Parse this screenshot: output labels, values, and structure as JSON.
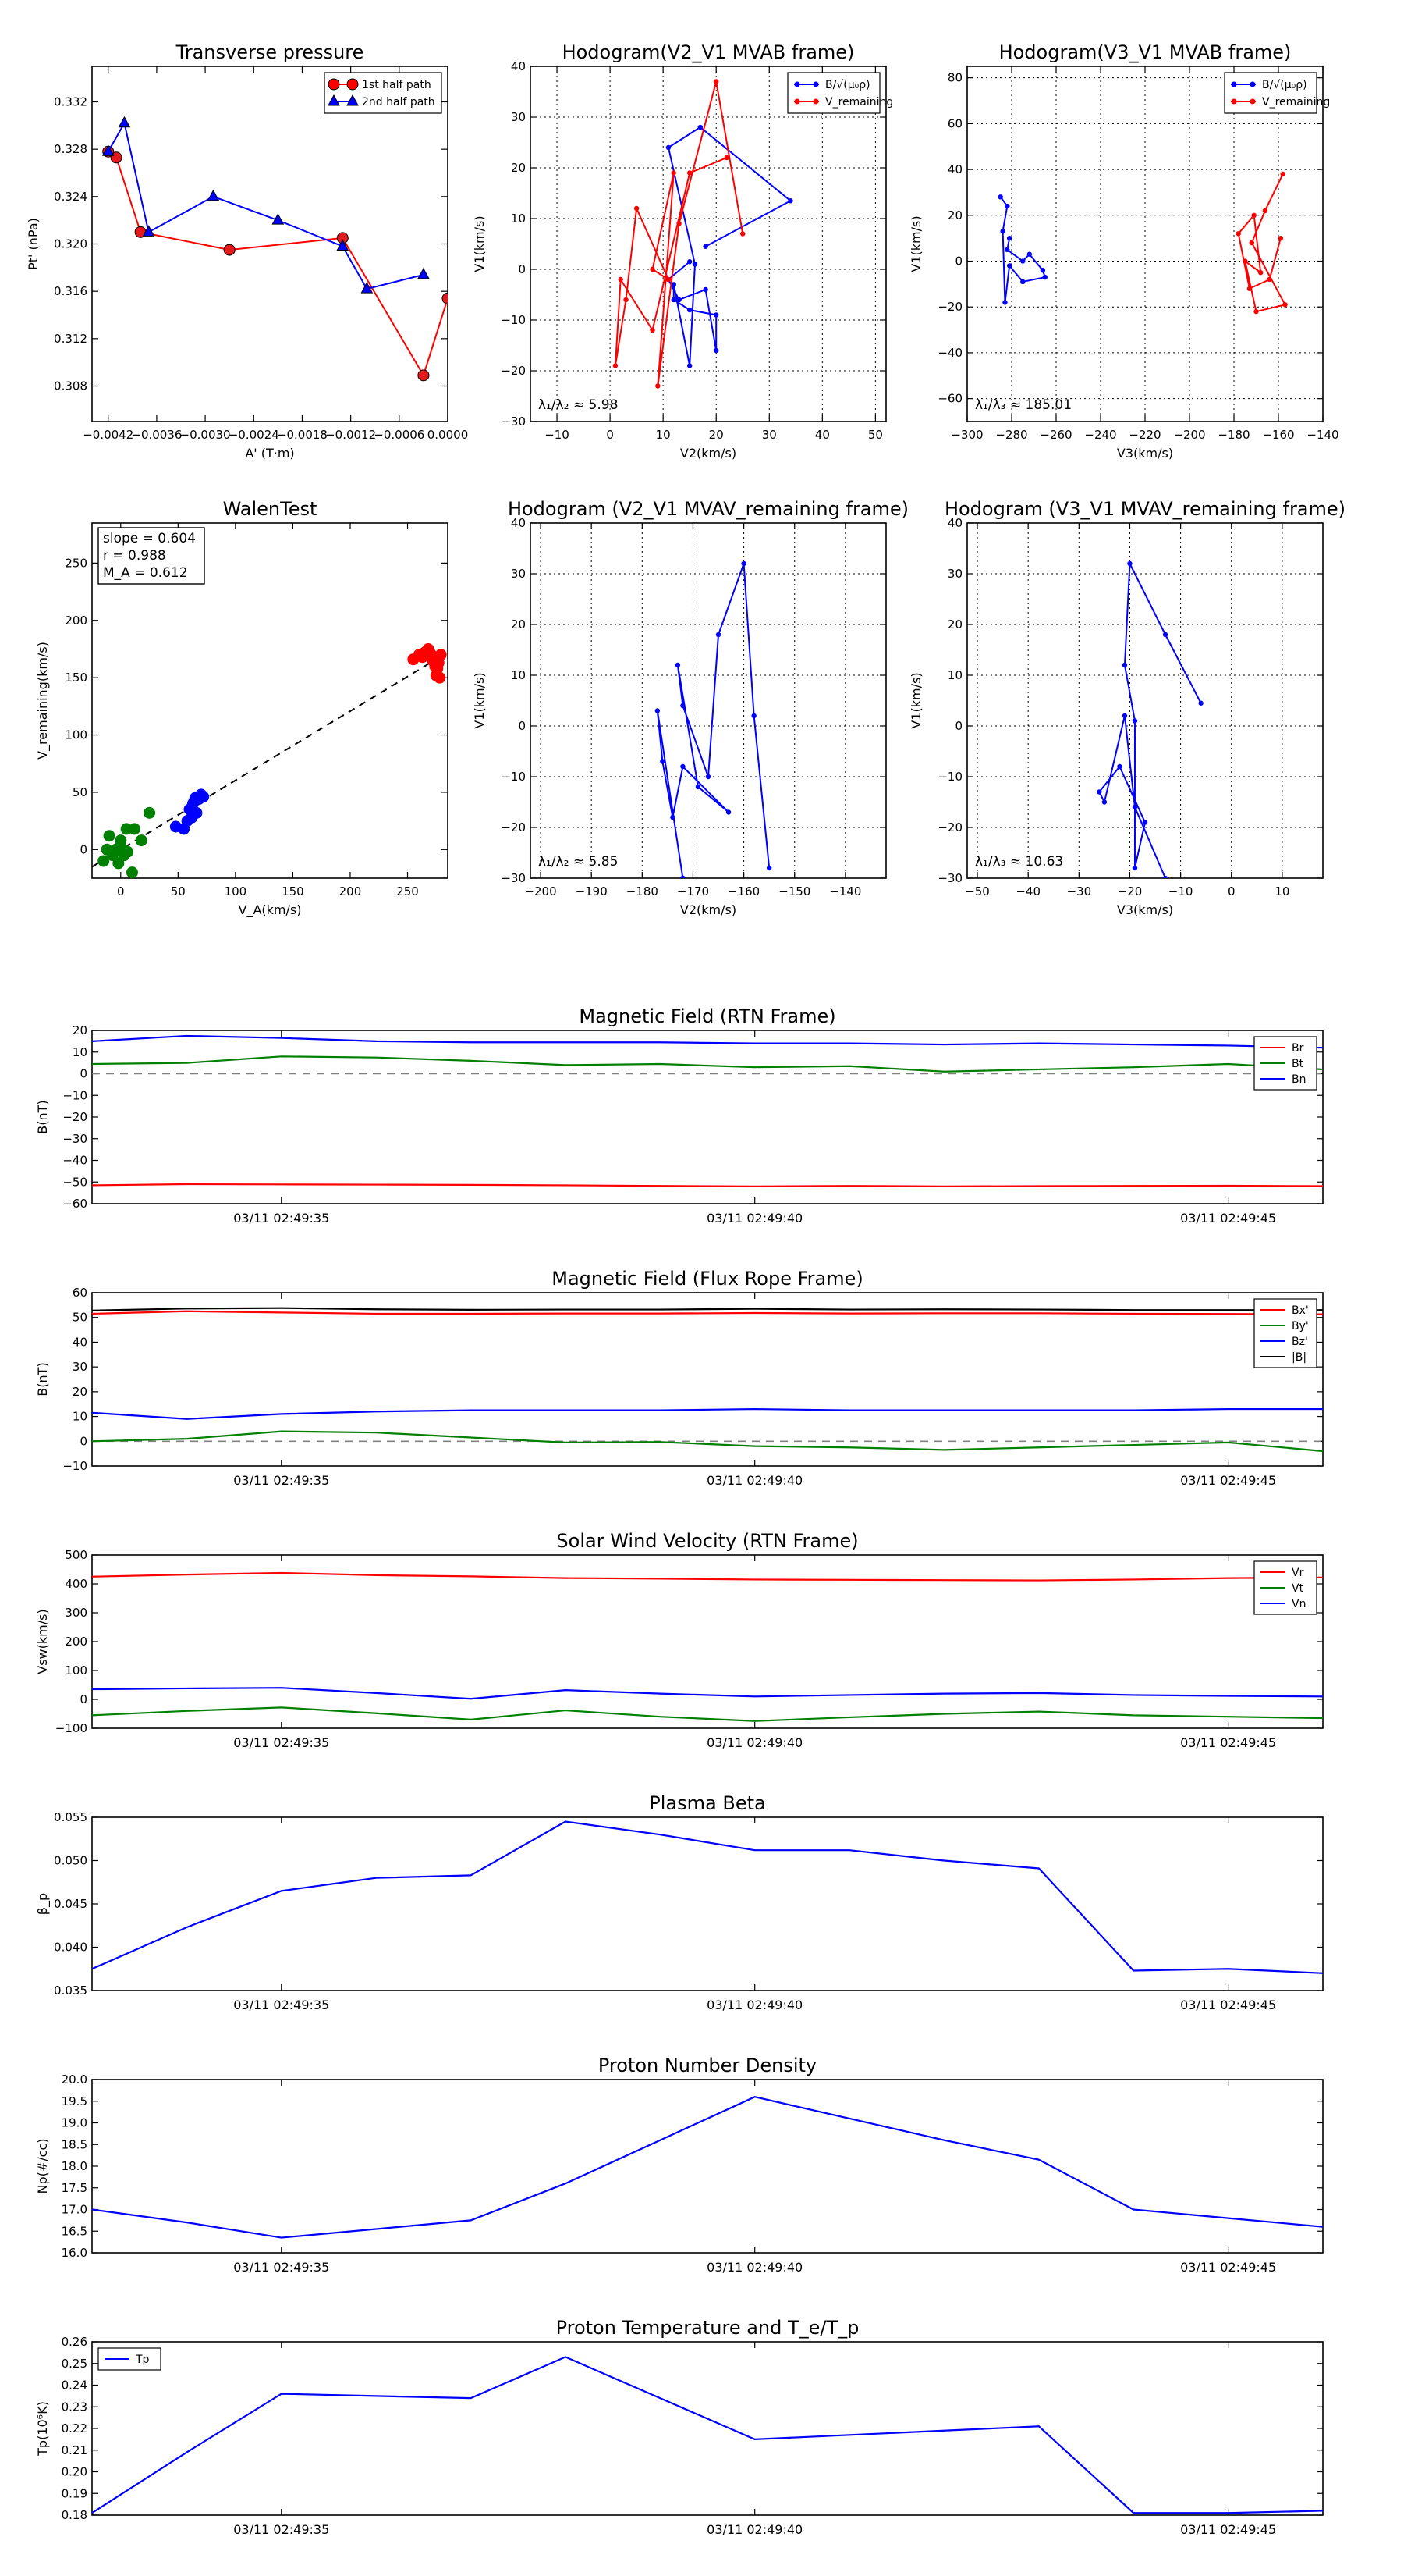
{
  "figure": {
    "background": "#ffffff",
    "colors": {
      "red": "#ff0000",
      "blue": "#0000ff",
      "green": "#008000",
      "black": "#000000",
      "gray": "#808080",
      "marker_red": "#e31a1c"
    }
  },
  "chart_data": [
    {
      "id": "pt",
      "type": "scatter",
      "title": "Transverse pressure",
      "xlabel": "A' (T·m)",
      "ylabel": "Pt' (nPa)",
      "xlim": [
        -0.0044,
        0.0
      ],
      "ylim": [
        0.305,
        0.335
      ],
      "xticks": [
        -0.0042,
        -0.0036,
        -0.003,
        -0.0024,
        -0.0018,
        -0.0012,
        -0.0006,
        0.0
      ],
      "xticklabels": [
        "−0.0042",
        "−0.0036",
        "−0.0030",
        "−0.0024",
        "−0.0018",
        "−0.0012",
        "−0.0006",
        "0.0000"
      ],
      "yticks": [
        0.308,
        0.312,
        0.316,
        0.32,
        0.324,
        0.328,
        0.332
      ],
      "yticklabels": [
        "0.308",
        "0.312",
        "0.316",
        "0.320",
        "0.324",
        "0.328",
        "0.332"
      ],
      "grid": false,
      "legend": "top-right",
      "series": [
        {
          "name": "1st half path",
          "color": "#ff0000",
          "marker": "o",
          "x": [
            0.0,
            -0.0003,
            -0.0013,
            -0.0027,
            -0.0038,
            -0.0041,
            -0.0042
          ],
          "y": [
            0.3154,
            0.3089,
            0.3205,
            0.3195,
            0.321,
            0.3273,
            0.3278
          ]
        },
        {
          "name": "2nd half path",
          "color": "#0000ff",
          "marker": "^",
          "x": [
            -0.0042,
            -0.004,
            -0.0037,
            -0.0029,
            -0.0021,
            -0.0013,
            -0.001,
            -0.0003
          ],
          "y": [
            0.3278,
            0.3302,
            0.321,
            0.324,
            0.322,
            0.3198,
            0.3162,
            0.3174
          ]
        }
      ]
    },
    {
      "id": "h1",
      "type": "line",
      "title": "Hodogram(V2_V1 MVAB frame)",
      "xlabel": "V2(km/s)",
      "ylabel": "V1(km/s)",
      "xlim": [
        -15,
        52
      ],
      "ylim": [
        -30,
        40
      ],
      "xticks": [
        -10,
        0,
        10,
        20,
        30,
        40,
        50
      ],
      "yticks": [
        -30,
        -20,
        -10,
        0,
        10,
        20,
        30,
        40
      ],
      "grid": true,
      "legend": "top-right",
      "annotation": "λ₁/λ₂ ≈ 5.98",
      "series": [
        {
          "name": "B/√(μ₀ρ)",
          "color": "#0000ff",
          "x": [
            18,
            34,
            17,
            11,
            16,
            15,
            12,
            12,
            15,
            20,
            20,
            18,
            13,
            11,
            15
          ],
          "y": [
            4.5,
            13.5,
            28,
            24,
            1,
            -19,
            -3,
            -6,
            -8,
            -9,
            -16,
            -4,
            -6,
            -2,
            1.5
          ]
        },
        {
          "name": "V_remaining",
          "color": "#ff0000",
          "x": [
            25,
            20,
            13,
            9,
            12,
            8,
            11,
            5,
            3,
            1,
            2,
            8,
            15,
            22
          ],
          "y": [
            7,
            37,
            9,
            -23,
            19,
            0,
            -2,
            12,
            -6,
            -19,
            -2,
            -12,
            19,
            22
          ]
        }
      ]
    },
    {
      "id": "h2",
      "type": "line",
      "title": "Hodogram(V3_V1 MVAB frame)",
      "xlabel": "V3(km/s)",
      "ylabel": "V1(km/s)",
      "xlim": [
        -300,
        -140
      ],
      "ylim": [
        -70,
        85
      ],
      "xticks": [
        -300,
        -280,
        -260,
        -240,
        -220,
        -200,
        -180,
        -160,
        -140
      ],
      "yticks": [
        -60,
        -40,
        -20,
        0,
        20,
        40,
        60,
        80
      ],
      "grid": true,
      "legend": "top-right",
      "annotation": "λ₁/λ₃ ≈ 185.01",
      "series": [
        {
          "name": "B/√(μ₀ρ)",
          "color": "#0000ff",
          "x": [
            -285,
            -282,
            -284,
            -283,
            -281,
            -275,
            -265,
            -266,
            -272,
            -275,
            -282,
            -281
          ],
          "y": [
            28,
            24,
            13,
            -18,
            -2,
            -9,
            -7,
            -4,
            3,
            0,
            5,
            10
          ]
        },
        {
          "name": "V_remaining",
          "color": "#ff0000",
          "x": [
            -158,
            -166,
            -172,
            -157,
            -170,
            -175,
            -168,
            -171,
            -178,
            -173,
            -164,
            -159
          ],
          "y": [
            38,
            22,
            8,
            -19,
            -22,
            0,
            -5,
            20,
            12,
            -12,
            -8,
            10
          ]
        }
      ]
    },
    {
      "id": "walen",
      "type": "scatter",
      "title": "WalenTest",
      "xlabel": "V_A(km/s)",
      "ylabel": "V_remaining(km/s)",
      "xlim": [
        -25,
        285
      ],
      "ylim": [
        -25,
        285
      ],
      "xticks": [
        0,
        50,
        100,
        150,
        200,
        250
      ],
      "yticks": [
        0,
        50,
        100,
        150,
        200,
        250
      ],
      "grid": false,
      "fit_text": [
        "slope = 0.604",
        "r = 0.988",
        "M_A = 0.612"
      ],
      "fit": {
        "slope": 0.604,
        "x_range": [
          -25,
          270
        ]
      },
      "series": [
        {
          "name": "",
          "color": "#008000",
          "x": [
            -15,
            -10,
            -7,
            -4,
            -2,
            0,
            2,
            5,
            6,
            10,
            12,
            18,
            25,
            -12,
            3,
            0
          ],
          "y": [
            -10,
            12,
            -5,
            0,
            -12,
            3,
            0,
            18,
            -2,
            -20,
            18,
            8,
            32,
            0,
            -5,
            8
          ]
        },
        {
          "name": "",
          "color": "#0000ff",
          "x": [
            48,
            55,
            58,
            60,
            62,
            63,
            64,
            65,
            66,
            68,
            70,
            72
          ],
          "y": [
            20,
            18,
            25,
            35,
            28,
            40,
            42,
            45,
            32,
            44,
            48,
            46
          ]
        },
        {
          "name": "",
          "color": "#ff0000",
          "x": [
            255,
            260,
            263,
            265,
            268,
            270,
            272,
            274,
            275,
            276,
            277,
            278,
            279
          ],
          "y": [
            166,
            170,
            168,
            172,
            175,
            171,
            165,
            160,
            152,
            158,
            163,
            150,
            170
          ]
        }
      ]
    },
    {
      "id": "h3",
      "type": "line",
      "title": "Hodogram (V2_V1 MVAV_remaining frame)",
      "xlabel": "V2(km/s)",
      "ylabel": "V1(km/s)",
      "xlim": [
        -202,
        -132
      ],
      "ylim": [
        -30,
        40
      ],
      "xticks": [
        -200,
        -190,
        -180,
        -170,
        -160,
        -150,
        -140
      ],
      "yticks": [
        -30,
        -20,
        -10,
        0,
        10,
        20,
        30,
        40
      ],
      "grid": true,
      "annotation": "λ₁/λ₂ ≈ 5.85",
      "series": [
        {
          "name": "",
          "color": "#0000ff",
          "x": [
            -155,
            -158,
            -160,
            -165,
            -167,
            -172,
            -173,
            -169,
            -163,
            -172,
            -174,
            -176,
            -177,
            -172,
            -172
          ],
          "y": [
            -28,
            2,
            32,
            18,
            -10,
            4,
            12,
            -12,
            -17,
            -8,
            -18,
            -7,
            3,
            -30,
            -30
          ]
        }
      ]
    },
    {
      "id": "h4",
      "type": "line",
      "title": "Hodogram (V3_V1 MVAV_remaining frame)",
      "xlabel": "V3(km/s)",
      "ylabel": "V1(km/s)",
      "xlim": [
        -52,
        18
      ],
      "ylim": [
        -30,
        40
      ],
      "xticks": [
        -50,
        -40,
        -30,
        -20,
        -10,
        0,
        10
      ],
      "yticks": [
        -30,
        -20,
        -10,
        0,
        10,
        20,
        30,
        40
      ],
      "grid": true,
      "annotation": "λ₁/λ₃ ≈ 10.63",
      "series": [
        {
          "name": "",
          "color": "#0000ff",
          "x": [
            -6,
            -13,
            -20,
            -21,
            -19,
            -19,
            -17,
            -22,
            -26,
            -25,
            -21,
            -19,
            -13
          ],
          "y": [
            4.5,
            18,
            32,
            12,
            1,
            -28,
            -19,
            -8,
            -13,
            -15,
            2,
            -16,
            -30
          ]
        }
      ]
    }
  ],
  "timeseries": {
    "xlim": [
      0,
      13
    ],
    "xticks": [
      2,
      7,
      12
    ],
    "xticklabels": [
      "03/11 02:49:35",
      "03/11 02:49:40",
      "03/11 02:49:45"
    ],
    "panels": [
      {
        "id": "b_rtn",
        "title": "Magnetic Field (RTN Frame)",
        "ylabel": "B(nT)",
        "ylim": [
          -60,
          20
        ],
        "yticks": [
          -60,
          -50,
          -40,
          -30,
          -20,
          -10,
          0,
          10,
          20
        ],
        "zero_line": true,
        "legend": "top-right",
        "x": [
          0,
          1,
          2,
          3,
          4,
          5,
          6,
          7,
          8,
          9,
          10,
          11,
          12,
          13
        ],
        "series": [
          {
            "name": "Br",
            "color": "#ff0000",
            "values": [
              -51.5,
              -51,
              -51.1,
              -51.2,
              -51.3,
              -51.5,
              -51.8,
              -52,
              -51.8,
              -52,
              -51.9,
              -51.8,
              -51.7,
              -51.9
            ]
          },
          {
            "name": "Bt",
            "color": "#008000",
            "values": [
              4.5,
              5,
              8,
              7.5,
              6,
              4,
              4.5,
              3,
              3.5,
              1,
              2,
              3,
              4.5,
              2
            ]
          },
          {
            "name": "Bn",
            "color": "#0000ff",
            "values": [
              15,
              17.5,
              16.5,
              15,
              14.5,
              14.5,
              14.5,
              14,
              14,
              13.5,
              14,
              13.5,
              13,
              12
            ]
          }
        ]
      },
      {
        "id": "b_fr",
        "title": "Magnetic Field (Flux Rope Frame)",
        "ylabel": "B(nT)",
        "ylim": [
          -10,
          60
        ],
        "yticks": [
          -10,
          0,
          10,
          20,
          30,
          40,
          50,
          60
        ],
        "zero_line": true,
        "legend": "top-right",
        "x": [
          0,
          1,
          2,
          3,
          4,
          5,
          6,
          7,
          8,
          9,
          10,
          11,
          12,
          13
        ],
        "series": [
          {
            "name": "Bx'",
            "color": "#ff0000",
            "values": [
              51.5,
              52.5,
              52,
              51.5,
              51.5,
              51.6,
              51.6,
              51.8,
              51.6,
              51.7,
              51.7,
              51.5,
              51.4,
              51.3
            ]
          },
          {
            "name": "By'",
            "color": "#008000",
            "values": [
              0,
              1,
              4,
              3.5,
              1.5,
              -0.5,
              -0.3,
              -2,
              -2.5,
              -3.5,
              -2.5,
              -1.5,
              -0.5,
              -4
            ]
          },
          {
            "name": "Bz'",
            "color": "#0000ff",
            "values": [
              11.5,
              9,
              11,
              12,
              12.5,
              12.5,
              12.5,
              13,
              12.5,
              12.5,
              12.5,
              12.5,
              13,
              13
            ]
          },
          {
            "name": "|B|",
            "color": "#000000",
            "values": [
              52.8,
              53.6,
              53.8,
              53.3,
              53.1,
              53.2,
              53.2,
              53.5,
              53.2,
              53.3,
              53.2,
              53,
              53,
              53
            ]
          }
        ]
      },
      {
        "id": "v_rtn",
        "title": "Solar Wind Velocity (RTN Frame)",
        "ylabel": "Vsw(km/s)",
        "ylim": [
          -100,
          500
        ],
        "yticks": [
          -100,
          0,
          100,
          200,
          300,
          400,
          500
        ],
        "zero_line": false,
        "legend": "top-right",
        "x": [
          0,
          1,
          2,
          3,
          4,
          5,
          6,
          7,
          8,
          9,
          10,
          11,
          12,
          13
        ],
        "series": [
          {
            "name": "Vr",
            "color": "#ff0000",
            "values": [
              425,
              432,
              438,
              430,
              426,
              420,
              418,
              415,
              414,
              413,
              412,
              415,
              420,
              422
            ]
          },
          {
            "name": "Vt",
            "color": "#008000",
            "values": [
              -55,
              -40,
              -28,
              -48,
              -70,
              -38,
              -60,
              -75,
              -62,
              -50,
              -42,
              -55,
              -60,
              -65
            ]
          },
          {
            "name": "Vn",
            "color": "#0000ff",
            "values": [
              35,
              38,
              40,
              22,
              2,
              32,
              20,
              10,
              15,
              20,
              22,
              15,
              12,
              10
            ]
          }
        ]
      },
      {
        "id": "beta",
        "title": "Plasma Beta",
        "ylabel": "β_p",
        "ylim": [
          0.035,
          0.055
        ],
        "yticks": [
          0.035,
          0.04,
          0.045,
          0.05,
          0.055
        ],
        "ytickfmt": 3,
        "zero_line": false,
        "x": [
          0,
          1,
          2,
          3,
          4,
          5,
          6,
          7,
          8,
          9,
          10,
          11,
          12,
          13
        ],
        "series": [
          {
            "name": "",
            "color": "#0000ff",
            "values": [
              0.0375,
              0.0423,
              0.0465,
              0.048,
              0.0483,
              0.0545,
              0.053,
              0.0512,
              0.0512,
              0.05,
              0.0491,
              0.0373,
              0.0375,
              0.037
            ]
          }
        ]
      },
      {
        "id": "np",
        "title": "Proton Number Density",
        "ylabel": "Np(#/cc)",
        "ylim": [
          16.0,
          20.0
        ],
        "yticks": [
          16.0,
          16.5,
          17.0,
          17.5,
          18.0,
          18.5,
          19.0,
          19.5,
          20.0
        ],
        "ytickfmt": 1,
        "zero_line": false,
        "x": [
          0,
          1,
          2,
          3,
          4,
          5,
          6,
          7,
          8,
          9,
          10,
          11,
          12,
          13
        ],
        "series": [
          {
            "name": "",
            "color": "#0000ff",
            "values": [
              17.0,
              16.7,
              16.35,
              16.55,
              16.75,
              17.6,
              18.6,
              19.6,
              19.1,
              18.6,
              18.15,
              17.0,
              16.8,
              16.6
            ]
          }
        ]
      },
      {
        "id": "tp",
        "title": "Proton Temperature and T_e/T_p",
        "ylabel": "Tp(10⁶K)",
        "ylim": [
          0.18,
          0.26
        ],
        "yticks": [
          0.18,
          0.19,
          0.2,
          0.21,
          0.22,
          0.23,
          0.24,
          0.25,
          0.26
        ],
        "ytickfmt": 2,
        "zero_line": false,
        "legend": "top-left",
        "x": [
          0,
          1,
          2,
          3,
          4,
          5,
          6,
          7,
          8,
          9,
          10,
          11,
          12,
          13
        ],
        "series": [
          {
            "name": "Tp",
            "color": "#0000ff",
            "values": [
              0.181,
              0.209,
              0.236,
              0.235,
              0.234,
              0.253,
              0.234,
              0.215,
              0.217,
              0.219,
              0.221,
              0.181,
              0.181,
              0.182
            ]
          }
        ]
      }
    ]
  }
}
